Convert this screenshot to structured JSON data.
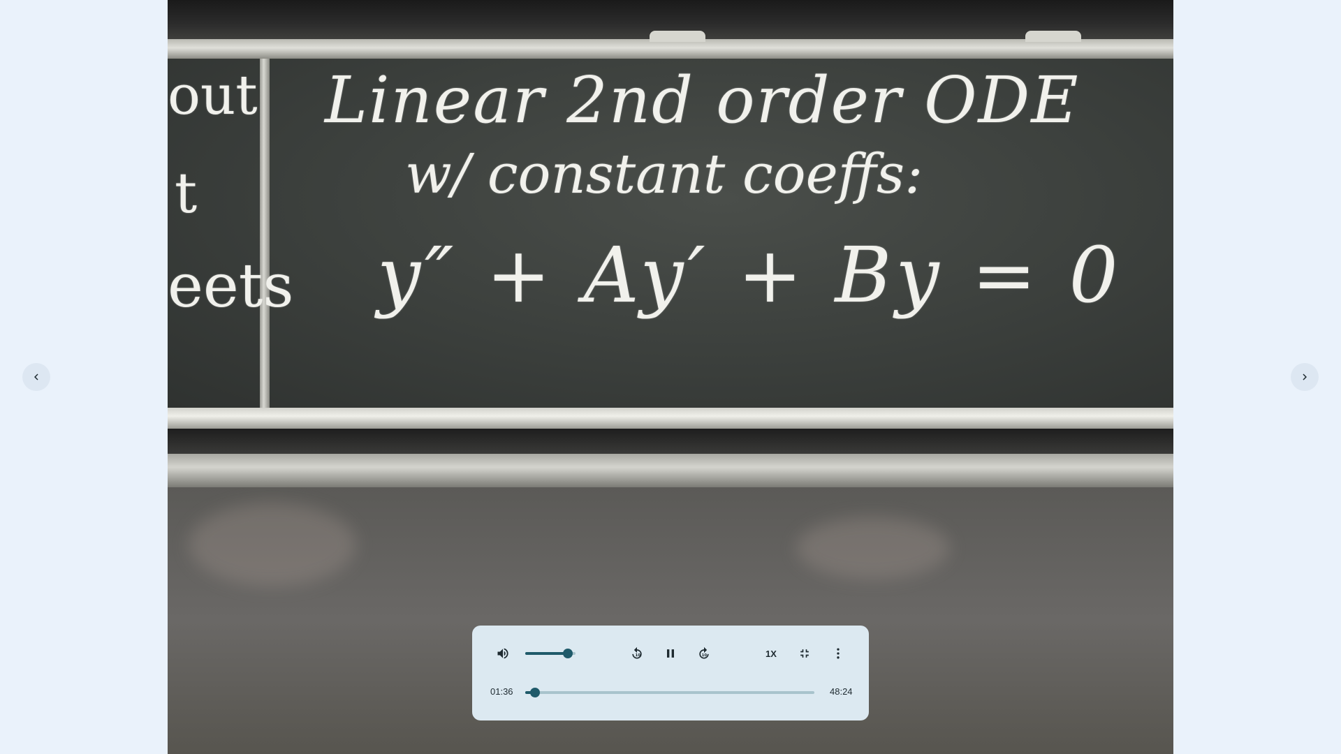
{
  "video": {
    "chalk_title": "Linear 2nd order ODE",
    "chalk_subtitle": "w/ constant coeffs:",
    "chalk_equation": "y″ + Ay′ + By = 0",
    "chalk_edge_1": "out",
    "chalk_edge_2": "t",
    "chalk_edge_3": "eets"
  },
  "player": {
    "current_time": "01:36",
    "duration": "48:24",
    "speed_label": "1X",
    "volume_level": 0.85,
    "progress": 0.033
  },
  "icons": {
    "prev": "chevron-left-icon",
    "next": "chevron-right-icon",
    "volume": "volume-icon",
    "rewind": "replay-10-icon",
    "pause": "pause-icon",
    "forward": "forward-10-icon",
    "exit_fullscreen": "exit-fullscreen-icon",
    "more": "more-vert-icon"
  }
}
